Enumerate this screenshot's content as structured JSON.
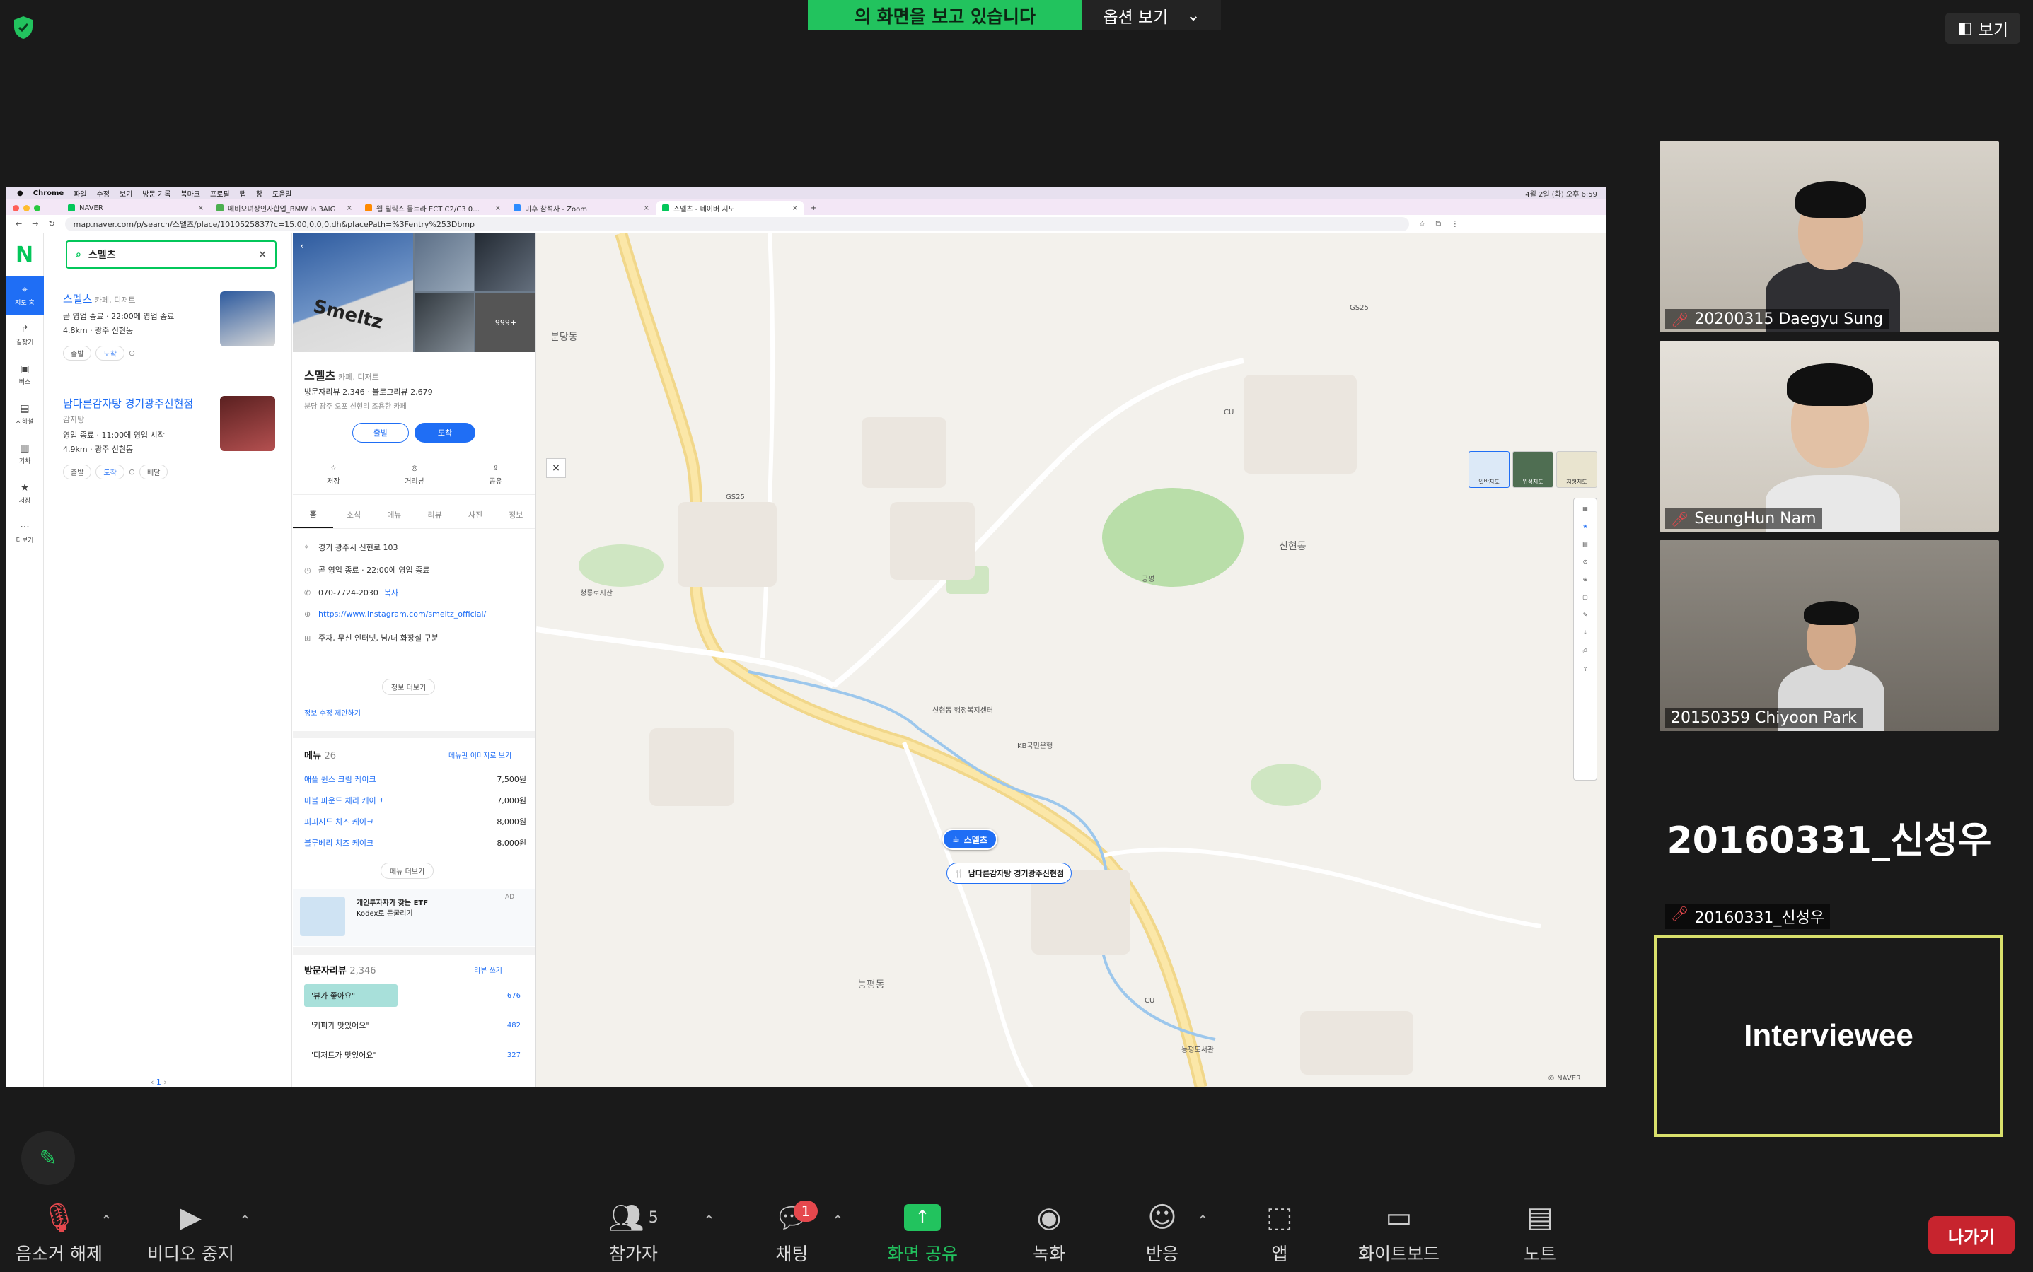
{
  "zoom": {
    "share_banner": "의 화면을 보고 있습니다",
    "options_label": "옵션 보기",
    "view_label": "보기",
    "participants": [
      {
        "name": "20200315 Daegyu Sung"
      },
      {
        "name": "SeungHun Nam"
      },
      {
        "name": "20150359 Chiyoon Park"
      },
      {
        "name": "20160331_신성우",
        "display": "20160331_신성우"
      }
    ],
    "interviewee_label": "Interviewee",
    "toolbar": {
      "unmute": "음소거 해제",
      "stop_video": "비디오 중지",
      "participants": "참가자",
      "participants_count": "5",
      "chat": "채팅",
      "chat_badge": "1",
      "share": "화면 공유",
      "record": "녹화",
      "reactions": "반응",
      "apps": "앱",
      "whiteboard": "화이트보드",
      "notes": "노트",
      "leave": "나가기"
    }
  },
  "screen": {
    "menubar": [
      "Chrome",
      "파일",
      "수정",
      "보기",
      "방문 기록",
      "북마크",
      "프로필",
      "탭",
      "창",
      "도움말"
    ],
    "clock": "4월 2일 (화) 오후 6:59",
    "tabs": [
      {
        "label": "NAVER",
        "color": "#03c75a"
      },
      {
        "label": "메비오녀상인사합업_BMW io 3AIG",
        "color": "#4caf50"
      },
      {
        "label": "웹 릴릭스 몰트라 ECT C2/C3 0…",
        "color": "#ff8a00"
      },
      {
        "label": "미후 참석자 - Zoom",
        "color": "#2d8cff"
      },
      {
        "label": "스멜츠 - 네이버 지도",
        "color": "#03c75a"
      }
    ],
    "url": "map.naver.com/p/search/스멜츠/place/1010525837?c=15.00,0,0,0,dh&placePath=%3Fentry%253Dbmp",
    "rail": [
      {
        "label": "지도 홈",
        "icon": "map-pin-icon"
      },
      {
        "label": "길찾기",
        "icon": "directions-icon"
      },
      {
        "label": "버스",
        "icon": "bus-icon"
      },
      {
        "label": "지하철",
        "icon": "subway-icon"
      },
      {
        "label": "기차",
        "icon": "train-icon"
      },
      {
        "label": "저장",
        "icon": "star-icon"
      },
      {
        "label": "더보기",
        "icon": "more-icon"
      }
    ],
    "search_query": "스멜츠",
    "results": [
      {
        "name": "스멜츠",
        "category": "카페, 디저트",
        "status": "곧 영업 종료 · 22:00에 영업 종료",
        "distance": "4.8km · 광주 신현동",
        "actions": [
          "출발",
          "도착"
        ]
      },
      {
        "name": "남다른감자탕 경기광주신현점",
        "category": "감자탕",
        "status": "영업 종료 · 11:00에 영업 시작",
        "distance": "4.9km · 광주 신현동",
        "actions": [
          "출발",
          "도착",
          "배달"
        ]
      }
    ],
    "pager": "1",
    "place": {
      "name": "스멜츠",
      "category": "카페, 디저트",
      "stats": "방문자리뷰 2,346 · 블로그리뷰 2,679",
      "desc": "분당 광주 오포 신현리 조용한 카페",
      "depart": "출발",
      "arrive": "도착",
      "actions": [
        "저장",
        "거리뷰",
        "공유"
      ],
      "tabs": [
        "홈",
        "소식",
        "메뉴",
        "리뷰",
        "사진",
        "정보"
      ],
      "address": "경기 광주시 신현로 103",
      "hours": "곧 영업 종료 · 22:00에 영업 종료",
      "phone": "070-7724-2030",
      "phone_copy": "복사",
      "link": "https://www.instagram.com/smeltz_official/",
      "amenities": "주차, 무선 인터넷, 남/녀 화장실 구분",
      "more_info": "정보 더보기",
      "edit_suggest": "정보 수정 제안하기",
      "menu_title": "메뉴",
      "menu_count": "26",
      "menu_photo": "메뉴판 이미지로 보기",
      "menu": [
        {
          "name": "애플 퀸스 크림 케이크",
          "price": "7,500원"
        },
        {
          "name": "마블 파운드 체리 케이크",
          "price": "7,000원"
        },
        {
          "name": "피피시드 치즈 케이크",
          "price": "8,000원"
        },
        {
          "name": "블루베리 치즈 케이크",
          "price": "8,000원"
        }
      ],
      "menu_more": "메뉴 더보기",
      "ad_title": "개인투자자가 찾는 ETF",
      "ad_sub": "Kodex로 돈굴리기",
      "ad_tag": "AD",
      "review_title": "방문자리뷰",
      "review_count": "2,346",
      "review_write": "리뷰 쓰기",
      "reviews": [
        {
          "text": "\"뷰가 좋아요\"",
          "count": "676",
          "fill": 0.42
        },
        {
          "text": "\"커피가 맛있어요\"",
          "count": "482",
          "fill": 0.0
        },
        {
          "text": "\"디저트가 맛있어요\"",
          "count": "327",
          "fill": 0.0
        }
      ]
    },
    "map": {
      "types": [
        "일반지도",
        "위성지도",
        "지형지도"
      ],
      "pin_main": "스멜츠",
      "pin_second": "남다른감자탕 경기광주신현점",
      "labels": {
        "bundang": "분당동",
        "sinhyeon": "신현동",
        "neungpyeong": "능평동",
        "bank": "KB국민은행",
        "center": "신현동 행정복지센터",
        "library": "능평도서관",
        "station": "청룡로지산",
        "park": "궁평",
        "gs": "GS25",
        "cu": "CU"
      },
      "copyright": "© NAVER"
    }
  }
}
